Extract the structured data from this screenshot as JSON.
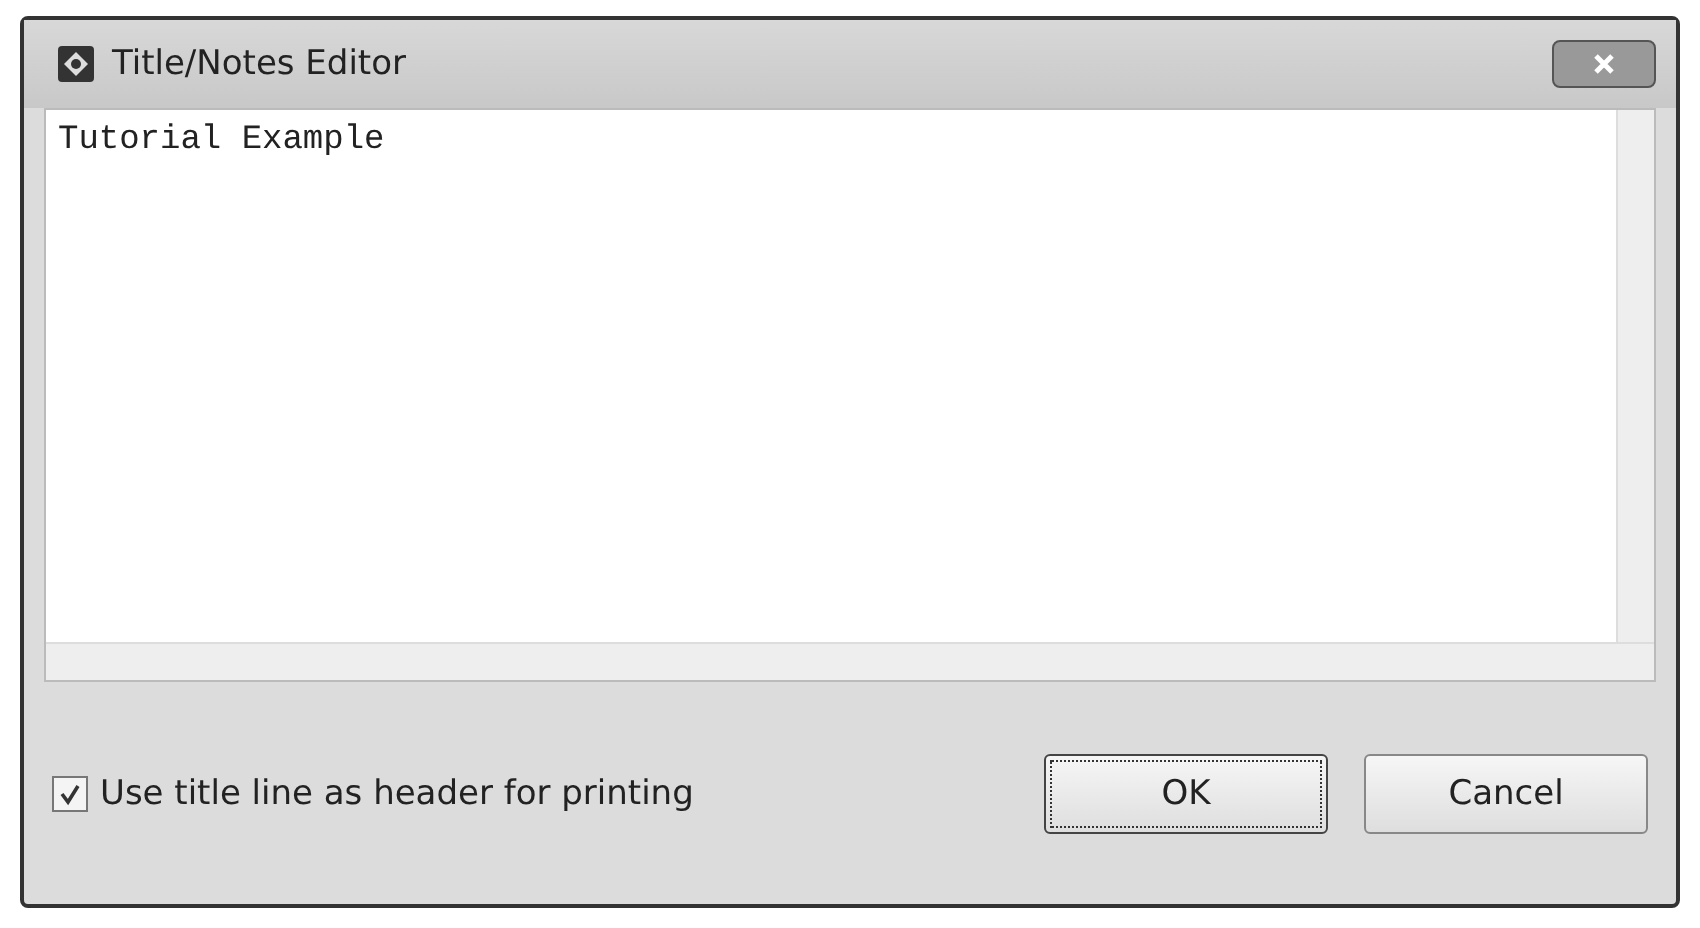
{
  "window": {
    "title": "Title/Notes Editor"
  },
  "editor": {
    "value": "Tutorial Example"
  },
  "option": {
    "label": "Use title line as header for printing",
    "checked": true
  },
  "buttons": [
    {
      "label": "OK",
      "focused": true
    },
    {
      "label": "Cancel",
      "focused": false
    }
  ]
}
